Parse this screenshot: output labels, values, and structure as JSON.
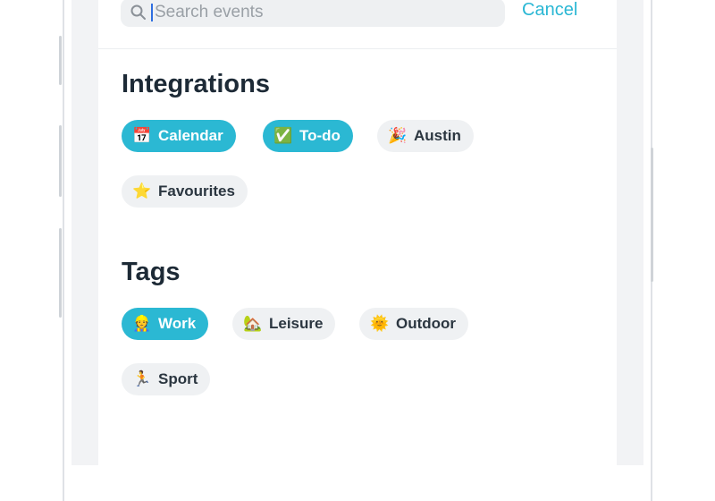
{
  "search": {
    "placeholder": "Search events",
    "cancel_label": "Cancel"
  },
  "integrations": {
    "title": "Integrations",
    "chips": [
      {
        "emoji": "📅",
        "label": "Calendar",
        "active": true
      },
      {
        "emoji": "✅",
        "label": "To-do",
        "active": true
      },
      {
        "emoji": "🎉",
        "label": "Austin",
        "active": false
      },
      {
        "emoji": "⭐",
        "label": "Favourites",
        "active": false
      }
    ]
  },
  "tags": {
    "title": "Tags",
    "chips": [
      {
        "emoji": "👷",
        "label": "Work",
        "active": true
      },
      {
        "emoji": "🏡",
        "label": "Leisure",
        "active": false
      },
      {
        "emoji": "🌞",
        "label": "Outdoor",
        "active": false
      },
      {
        "emoji": "🏃",
        "label": "Sport",
        "active": false
      }
    ]
  },
  "colors": {
    "accent": "#2bb8d3",
    "chip_inactive_bg": "#eff1f3",
    "title_text": "#1d2a36"
  }
}
